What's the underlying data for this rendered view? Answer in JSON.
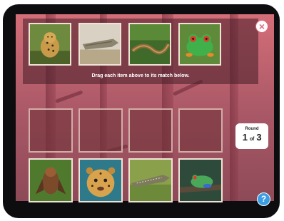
{
  "game": {
    "instruction": "Drag each item above to its match below.",
    "round": {
      "label": "Round",
      "current": "1",
      "separator": "of",
      "total": "3"
    },
    "close_icon": "×",
    "help_icon": "?"
  },
  "draggable_items": [
    {
      "name": "jaguar-photo"
    },
    {
      "name": "crocodile-photo"
    },
    {
      "name": "snake-photo"
    },
    {
      "name": "frog-photo"
    }
  ],
  "target_items": [
    {
      "name": "bat-photo"
    },
    {
      "name": "jaguar-face-photo"
    },
    {
      "name": "crocodile-photo"
    },
    {
      "name": "frog-photo"
    }
  ],
  "colors": {
    "background": "#c8636f",
    "close_button_border": "#e06b7c",
    "help_button": "#3a9ee4"
  }
}
